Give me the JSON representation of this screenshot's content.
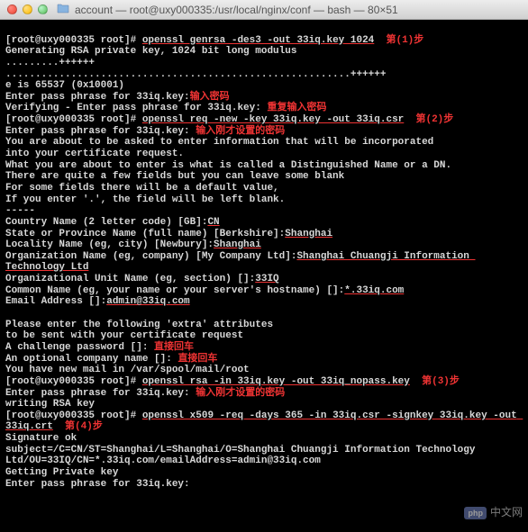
{
  "window": {
    "title": "account — root@uxy000335:/usr/local/nginx/conf — bash — 80×51"
  },
  "prompt": {
    "p1": "[root@uxy000335 root]# ",
    "cmd1": "openssl genrsa -des3 -out 33iq.key 1024",
    "step1": "第(1)步",
    "gen1": "Generating RSA private key, 1024 bit long modulus",
    "dots1": ".........++++++",
    "dots2": "..........................................................++++++",
    "eis": "e is 65537 (0x10001)",
    "enter1a": "Enter pass phrase for 33iq.key:",
    "note1": "输入密码",
    "verify": "Verifying - Enter pass phrase for 33iq.key: ",
    "note2": "重复输入密码",
    "p2": "[root@uxy000335 root]# ",
    "cmd2": "openssl req -new -key 33iq.key -out 33iq.csr",
    "step2": "第(2)步",
    "enter2": "Enter pass phrase for 33iq.key: ",
    "note3": "输入刚才设置的密码",
    "about1": "You are about to be asked to enter information that will be incorporated",
    "about2": "into your certificate request.",
    "about3": "What you are about to enter is what is called a Distinguished Name or a DN.",
    "about4": "There are quite a few fields but you can leave some blank",
    "about5": "For some fields there will be a default value,",
    "about6": "If you enter '.', the field will be left blank.",
    "dash": "-----",
    "cn_label": "Country Name (2 letter code) [GB]:",
    "cn_val": "CN",
    "st_label": "State or Province Name (full name) [Berkshire]:",
    "st_val": "Shanghai",
    "loc_label": "Locality Name (eg, city) [Newbury]:",
    "loc_val": "Shanghai",
    "org_label": "Organization Name (eg, company) [My Company Ltd]:",
    "org_val": "Shanghai Chuangji Information Technology Ltd",
    "ou_label": "Organizational Unit Name (eg, section) []:",
    "ou_val": "33IQ",
    "common_label": "Common Name (eg, your name or your server's hostname) []:",
    "common_val": "*.33iq.com",
    "email_label": "Email Address []:",
    "email_val": "admin@33iq.com",
    "extra1": "Please enter the following 'extra' attributes",
    "extra2": "to be sent with your certificate request",
    "chal": "A challenge password []: ",
    "note4": "直接回车",
    "optcomp": "An optional company name []: ",
    "note5": "直接回车",
    "mail": "You have new mail in /var/spool/mail/root",
    "p3": "[root@uxy000335 root]# ",
    "cmd3": "openssl rsa -in 33iq.key -out 33iq_nopass.key",
    "step3": "第(3)步",
    "enter3": "Enter pass phrase for 33iq.key: ",
    "note6": "输入刚才设置的密码",
    "writing": "writing RSA key",
    "p4": "[root@uxy000335 root]# ",
    "cmd4": "openssl x509 -req -days 365 -in 33iq.csr -signkey 33iq.key -out 33iq.crt",
    "step4": "第(4)步",
    "sigok": "Signature ok",
    "subject": "subject=/C=CN/ST=Shanghai/L=Shanghai/O=Shanghai Chuangji Information Technology Ltd/OU=33IQ/CN=*.33iq.com/emailAddress=admin@33iq.com",
    "getpriv": "Getting Private key",
    "enter4": "Enter pass phrase for 33iq.key:"
  },
  "watermark": {
    "badge": "php",
    "text": "中文网"
  }
}
